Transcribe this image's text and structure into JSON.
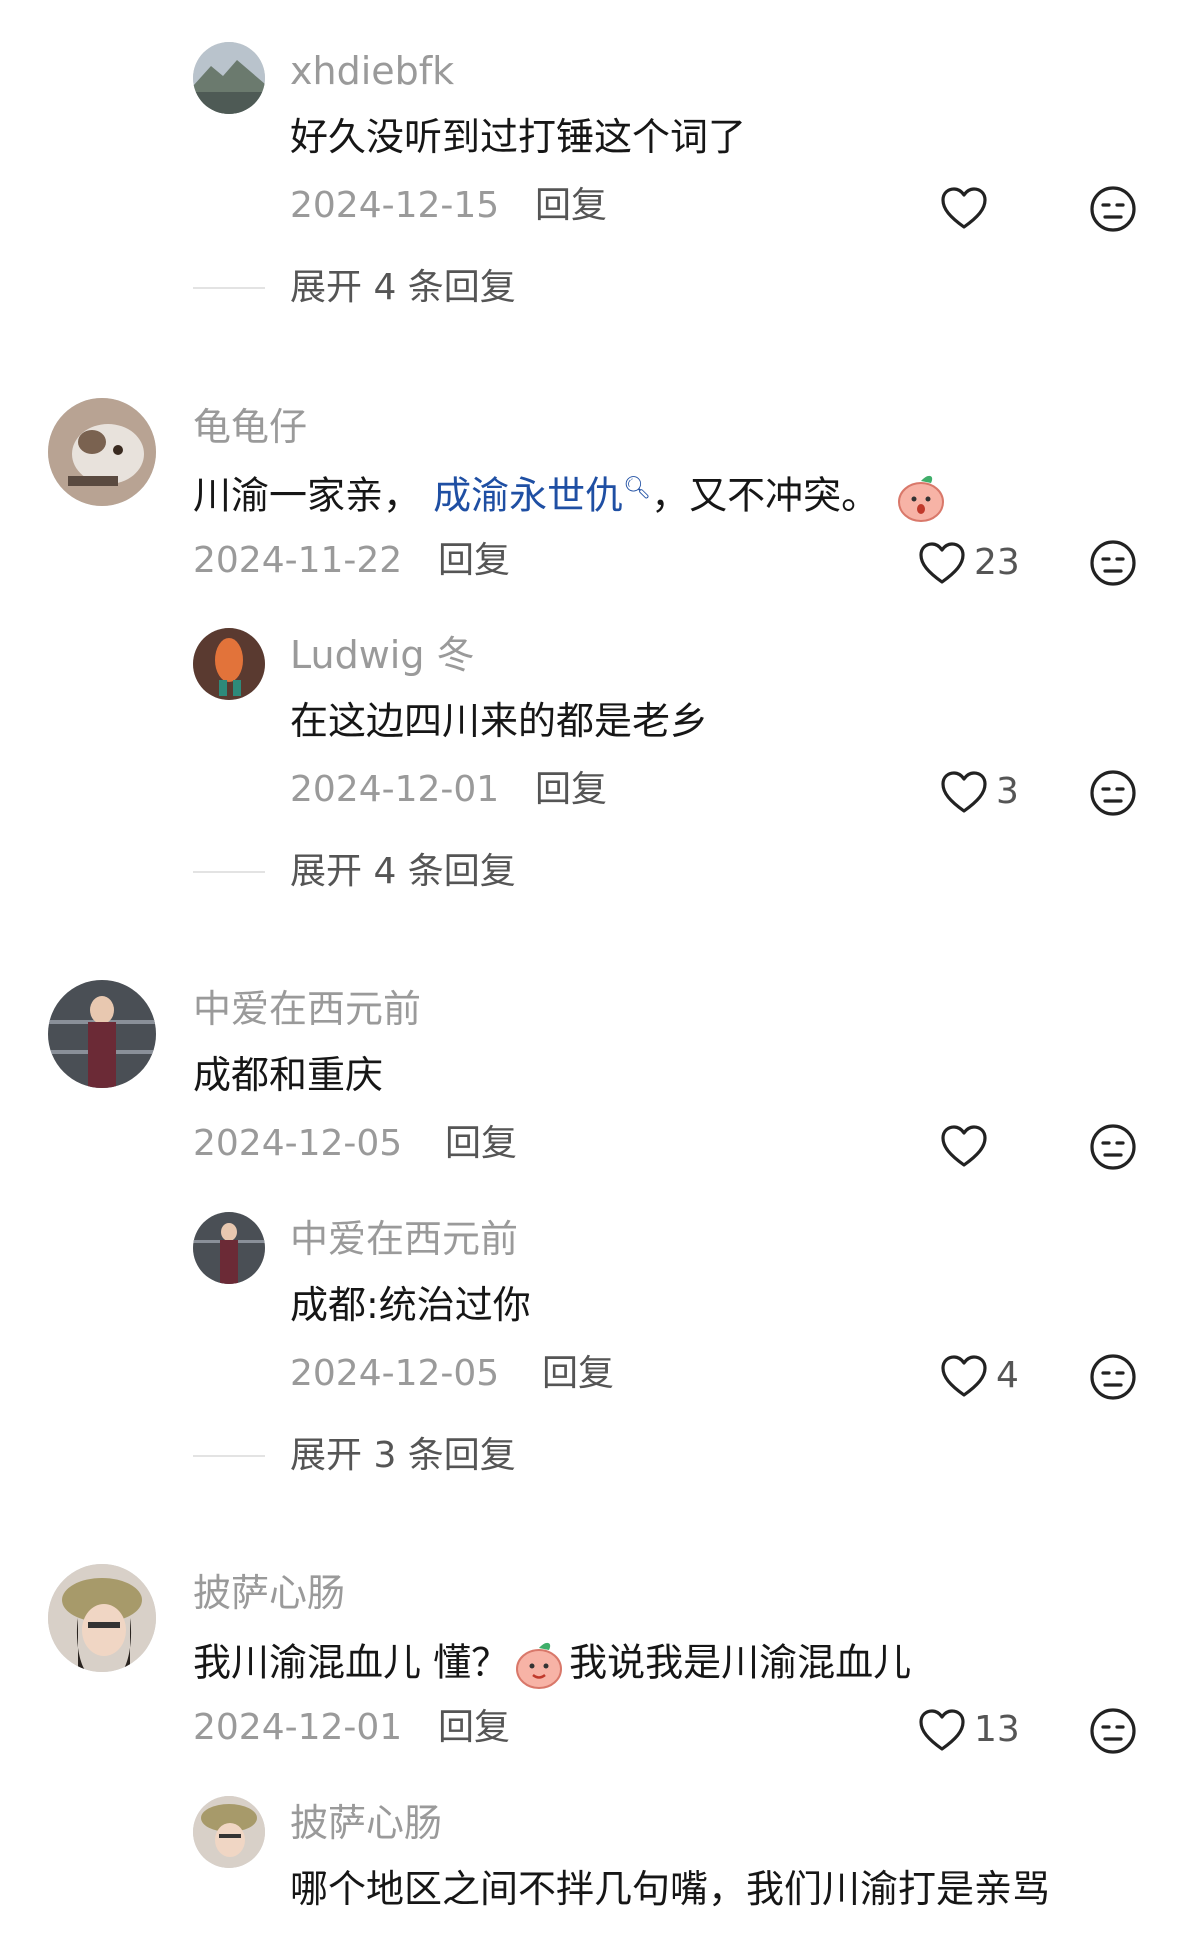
{
  "comments": [
    {
      "username": "xhdiebfk",
      "text": "好久没听到过打锤这个词了",
      "date": "2024-12-15",
      "reply_label": "回复",
      "likes": "",
      "expand": "展开 4 条回复"
    },
    {
      "username": "龟龟仔",
      "text_before": "川渝一家亲，",
      "text_link": "成渝永世仇",
      "text_after": "，又不冲突。",
      "date": "2024-11-22",
      "reply_label": "回复",
      "likes": "23",
      "replies": [
        {
          "username": "Ludwig 冬",
          "text": "在这边四川来的都是老乡",
          "date": "2024-12-01",
          "reply_label": "回复",
          "likes": "3"
        }
      ],
      "expand": "展开 4 条回复"
    },
    {
      "username": "中爱在西元前",
      "text": "成都和重庆",
      "date": "2024-12-05",
      "reply_label": "回复",
      "likes": "",
      "replies": [
        {
          "username": "中爱在西元前",
          "text": "成都:统治过你",
          "date": "2024-12-05",
          "reply_label": "回复",
          "likes": "4"
        }
      ],
      "expand": "展开 3 条回复"
    },
    {
      "username": "披萨心肠",
      "text_before": "我川渝混血儿 懂？",
      "text_after": "我说我是川渝混血儿",
      "date": "2024-12-01",
      "reply_label": "回复",
      "likes": "13",
      "replies": [
        {
          "username": "披萨心肠",
          "text": "哪个地区之间不拌几句嘴，我们川渝打是亲骂"
        }
      ]
    }
  ],
  "colors": {
    "username": "#9a9a9a",
    "text": "#161616",
    "link": "#1f4fa3",
    "meta": "#9a9a9a"
  }
}
